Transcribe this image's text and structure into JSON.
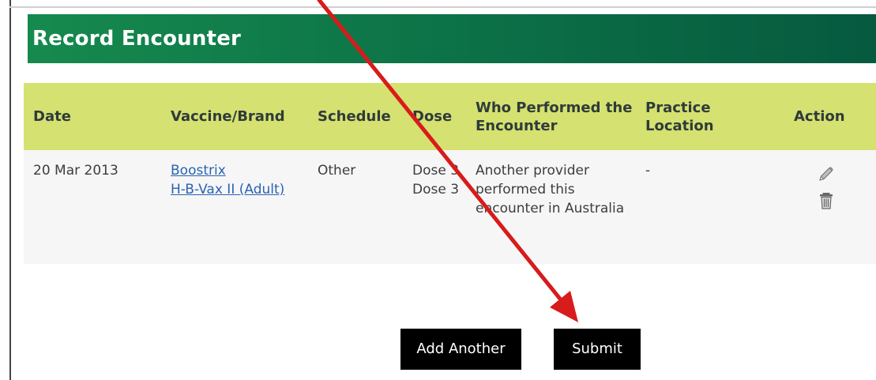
{
  "header": {
    "title": "Record Encounter"
  },
  "table": {
    "columns": [
      {
        "key": "date",
        "label": "Date"
      },
      {
        "key": "vaccine",
        "label": "Vaccine/Brand"
      },
      {
        "key": "schedule",
        "label": "Schedule"
      },
      {
        "key": "dose",
        "label": "Dose"
      },
      {
        "key": "who",
        "label": "Who Performed the Encounter"
      },
      {
        "key": "location",
        "label": "Practice Location"
      },
      {
        "key": "action",
        "label": "Action"
      }
    ],
    "rows": [
      {
        "date": "20 Mar 2013",
        "vaccines": [
          "Boostrix",
          "H-B-Vax II (Adult)"
        ],
        "schedule": "Other",
        "doses": [
          "Dose 3",
          "Dose 3"
        ],
        "who": "Another provider performed this encounter in Australia",
        "location": "-",
        "actions": [
          "pencil-icon",
          "trash-icon"
        ]
      }
    ]
  },
  "buttons": {
    "add_another": "Add Another",
    "submit": "Submit"
  },
  "colors": {
    "header_bg": "#0d7448",
    "table_header_bg": "#d5e170",
    "row_bg": "#f6f6f6",
    "link": "#2a63b5",
    "button_bg": "#000000",
    "annotation_arrow": "#d81b1b"
  }
}
